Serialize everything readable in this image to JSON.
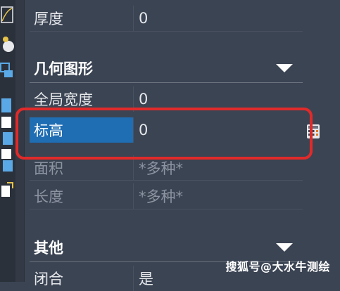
{
  "properties_geometry": {
    "thickness": {
      "label": "厚度",
      "value": "0"
    }
  },
  "section_geometry": {
    "title": "几何图形",
    "rows": [
      {
        "label": "全局宽度",
        "value": "0"
      },
      {
        "label": "标高",
        "value": "0"
      },
      {
        "label": "面积",
        "value": "*多种*"
      },
      {
        "label": "长度",
        "value": "*多种*"
      }
    ]
  },
  "section_other": {
    "title": "其他",
    "rows": [
      {
        "label": "闭合",
        "value": "是"
      }
    ]
  },
  "icons": {
    "calculator": "calculator-icon",
    "collapse": "triangle-down-icon"
  },
  "colors": {
    "highlight": "#e02a2a",
    "selection": "#1f6db3",
    "panel": "#3b4453"
  },
  "watermark": "搜狐号@大水牛测绘"
}
